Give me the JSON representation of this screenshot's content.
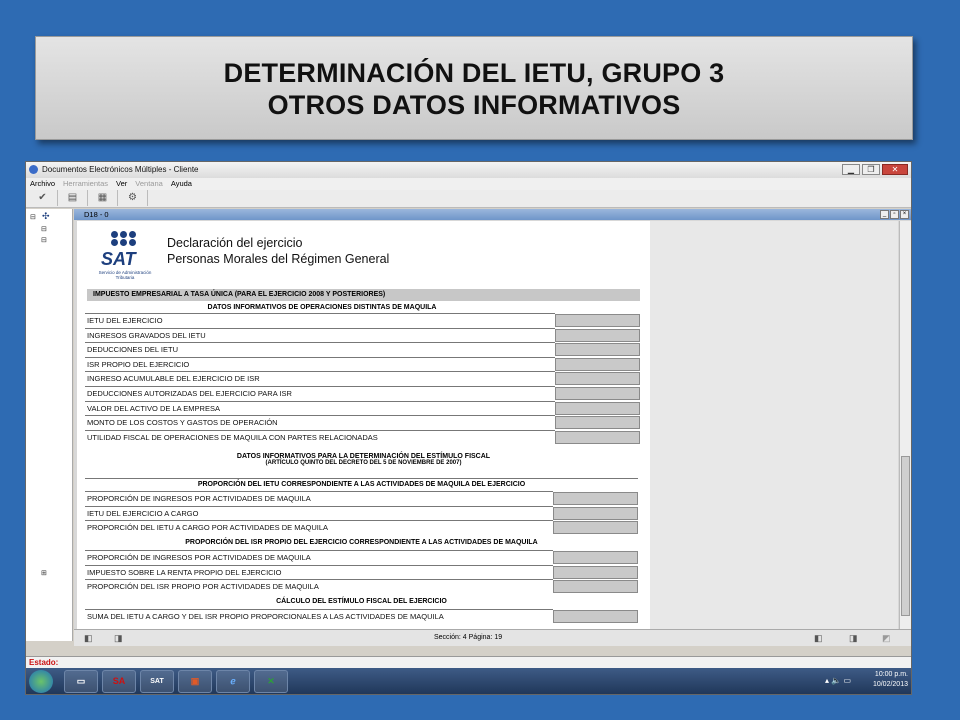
{
  "slide": {
    "title_line1": "DETERMINACIÓN DEL IETU, GRUPO 3",
    "title_line2": "OTROS DATOS INFORMATIVOS"
  },
  "window": {
    "title": "Documentos Electrónicos Múltiples - Cliente",
    "menu": [
      "Archivo",
      "Herramientas",
      "Ver",
      "Ventana",
      "Ayuda"
    ]
  },
  "document": {
    "tab_title": "D18 - 0",
    "logo_text": "SAT",
    "logo_sub": "Servicio de Administración Tributaria",
    "heading1": "Declaración del ejercicio",
    "heading2": "Personas Morales del Régimen General",
    "main_section": "IMPUESTO EMPRESARIAL A TASA ÚNICA (PARA EL EJERCICIO 2008 Y POSTERIORES)",
    "section1": "DATOS INFORMATIVOS DE OPERACIONES DISTINTAS DE MAQUILA",
    "rows1": [
      "IETU DEL EJERCICIO",
      "INGRESOS GRAVADOS DEL IETU",
      "DEDUCCIONES DEL IETU",
      "ISR PROPIO DEL EJERCICIO",
      "INGRESO ACUMULABLE DEL EJERCICIO DE ISR",
      "DEDUCCIONES AUTORIZADAS DEL EJERCICIO PARA ISR",
      "VALOR DEL ACTIVO DE LA EMPRESA",
      "MONTO DE LOS COSTOS Y GASTOS DE OPERACIÓN",
      "UTILIDAD FISCAL DE OPERACIONES DE MAQUILA CON PARTES RELACIONADAS"
    ],
    "section2_line1": "DATOS INFORMATIVOS PARA LA DETERMINACIÓN DEL ESTÍMULO FISCAL",
    "section2_line2": "(ARTÍCULO QUINTO DEL DECRETO DEL 5 DE NOVIEMBRE DE 2007)",
    "section3": "PROPORCIÓN DEL IETU CORRESPONDIENTE A LAS ACTIVIDADES DE MAQUILA DEL EJERCICIO",
    "rows3": [
      "PROPORCIÓN DE INGRESOS POR ACTIVIDADES DE MAQUILA",
      "IETU DEL EJERCICIO A CARGO",
      "PROPORCIÓN DEL IETU A CARGO POR ACTIVIDADES DE MAQUILA"
    ],
    "section4": "PROPORCIÓN DEL ISR PROPIO DEL EJERCICIO CORRESPONDIENTE A LAS ACTIVIDADES DE MAQUILA",
    "rows4": [
      "PROPORCIÓN DE INGRESOS POR ACTIVIDADES DE MAQUILA",
      "IMPUESTO SOBRE LA RENTA PROPIO DEL EJERCICIO",
      "PROPORCIÓN DEL ISR PROPIO POR ACTIVIDADES DE MAQUILA"
    ],
    "section5": "CÁLCULO DEL ESTÍMULO FISCAL DEL EJERCICIO",
    "rows5": [
      "SUMA DEL IETU A CARGO Y DEL ISR PROPIO PROPORCIONALES A LAS ACTIVIDADES DE MAQUILA"
    ]
  },
  "statusline": {
    "section_page": "Sección: 4  Página: 19"
  },
  "estado": "Estado:",
  "taskbar": {
    "time": "10:00 p.m.",
    "date": "10/02/2013",
    "items": [
      "SA",
      "SAT"
    ]
  }
}
